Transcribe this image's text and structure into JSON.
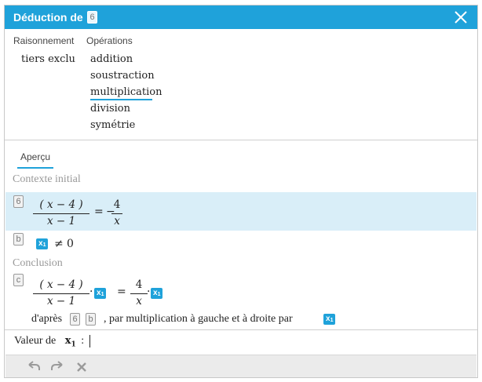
{
  "dialog": {
    "title": "Déduction de",
    "title_ref": "6",
    "close_icon": "close-icon"
  },
  "reasoning": {
    "header": "Raisonnement",
    "items": [
      "tiers exclu"
    ]
  },
  "operations": {
    "header": "Opérations",
    "items": [
      "addition",
      "soustraction",
      "multiplication",
      "division",
      "symétrie"
    ],
    "selected": "multiplication"
  },
  "preview": {
    "tab_label": "Aperçu",
    "context_label": "Contexte initial",
    "conclusion_label": "Conclusion",
    "stmt6": {
      "ref": "6",
      "lhs_num": "( x − 4 )",
      "lhs_den": "x − 1",
      "equals": "=",
      "minus": "−",
      "rhs_num": "4",
      "rhs_den": "x"
    },
    "stmtb": {
      "ref": "b",
      "var": "x",
      "var_sub": "1",
      "relation": "≠",
      "value": "0"
    },
    "stmtc": {
      "ref": "c",
      "lhs_num": "( x − 4 )",
      "lhs_den": "x − 1",
      "dot": "·",
      "equals": "=",
      "rhs_num": "4",
      "rhs_den": "x",
      "var": "x",
      "var_sub": "1"
    },
    "justification": {
      "prefix": "d'après",
      "ref1": "6",
      "ref2": "b",
      "text": ", par multiplication à gauche et à droite par",
      "var": "x",
      "var_sub": "1"
    }
  },
  "input": {
    "label": "Valeur de",
    "var": "x",
    "var_sub": "1",
    "colon": ":",
    "value": ""
  },
  "toolbar": {
    "undo_icon": "undo-icon",
    "redo_icon": "redo-icon",
    "clear_icon": "clear-icon"
  },
  "colors": {
    "accent": "#1fa2da",
    "highlight": "#d9eef8",
    "muted_text": "#999999"
  }
}
